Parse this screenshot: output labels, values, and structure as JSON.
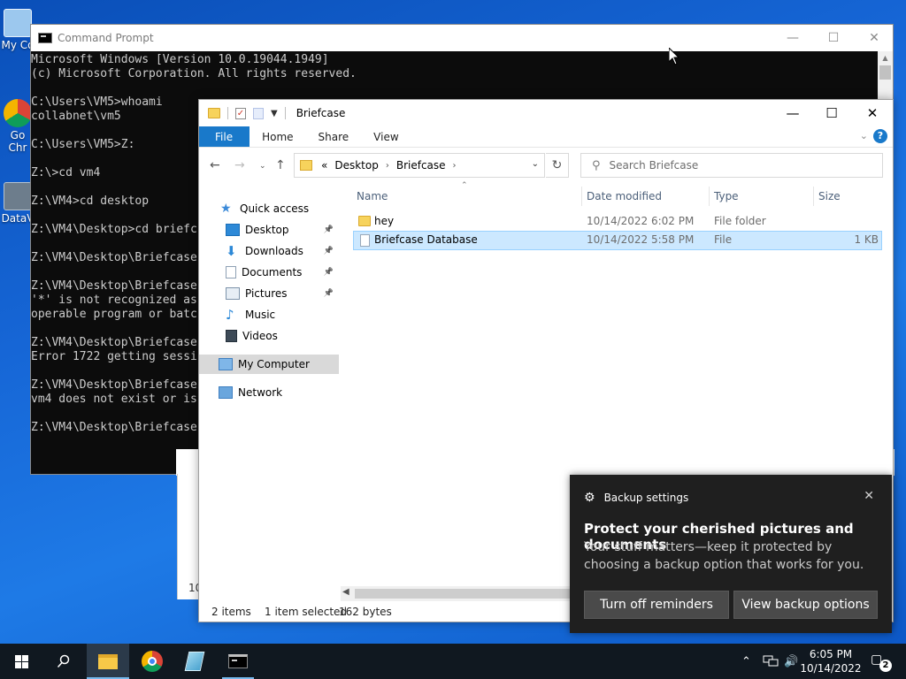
{
  "desktop": {
    "icons": [
      {
        "label": "My Co",
        "icon": "computer-icon"
      },
      {
        "label": "Go",
        "label2": "Chr",
        "icon": "chrome-icon"
      },
      {
        "label": "DataV",
        "icon": "datav-icon"
      }
    ]
  },
  "cmd": {
    "title": "Command Prompt",
    "lines": [
      "Microsoft Windows [Version 10.0.19044.1949]",
      "(c) Microsoft Corporation. All rights reserved.",
      "",
      "C:\\Users\\VM5>whoami",
      "collabnet\\vm5",
      "",
      "C:\\Users\\VM5>Z:",
      "",
      "Z:\\>cd vm4",
      "",
      "Z:\\VM4>cd desktop",
      "",
      "Z:\\VM4\\Desktop>cd briefc",
      "",
      "Z:\\VM4\\Desktop\\Briefcase",
      "",
      "Z:\\VM4\\Desktop\\Briefcase",
      "'*' is not recognized as",
      "operable program or batc",
      "",
      "Z:\\VM4\\Desktop\\Briefcase",
      "Error 1722 getting sessi",
      "",
      "Z:\\VM4\\Desktop\\Briefcase",
      "vm4 does not exist or is",
      "",
      "Z:\\VM4\\Desktop\\Briefcase"
    ]
  },
  "explorer": {
    "title": "Briefcase",
    "ribbon": {
      "file": "File",
      "home": "Home",
      "share": "Share",
      "view": "View"
    },
    "address": {
      "prefix": "«",
      "crumbs": [
        "Desktop",
        "Briefcase"
      ]
    },
    "search_placeholder": "Search Briefcase",
    "nav": [
      {
        "label": "Quick access",
        "icon": "star-icon"
      },
      {
        "label": "Desktop",
        "icon": "desktop-icon",
        "pinned": true
      },
      {
        "label": "Downloads",
        "icon": "download-icon",
        "pinned": true
      },
      {
        "label": "Documents",
        "icon": "document-icon",
        "pinned": true
      },
      {
        "label": "Pictures",
        "icon": "picture-icon",
        "pinned": true
      },
      {
        "label": "Music",
        "icon": "music-icon"
      },
      {
        "label": "Videos",
        "icon": "video-icon"
      },
      {
        "label": "My Computer",
        "icon": "computer-icon"
      },
      {
        "label": "Network",
        "icon": "network-icon"
      }
    ],
    "columns": {
      "name": "Name",
      "date": "Date modified",
      "type": "Type",
      "size": "Size"
    },
    "files": [
      {
        "name": "hey",
        "date": "10/14/2022 6:02 PM",
        "type": "File folder",
        "size": "",
        "icon": "folder-icon"
      },
      {
        "name": "Briefcase Database",
        "date": "10/14/2022 5:58 PM",
        "type": "File",
        "size": "1 KB",
        "icon": "file-icon"
      }
    ],
    "status": {
      "items": "2 items",
      "selected": "1 item selected",
      "bytes": "162 bytes"
    }
  },
  "background_window": {
    "text": "10"
  },
  "toast": {
    "header": "Backup settings",
    "title": "Protect your cherished pictures and documents",
    "body": "Your stuff matters—keep it protected by choosing a backup option that works for you.",
    "button1": "Turn off reminders",
    "button2": "View backup options"
  },
  "taskbar": {
    "time": "6:05 PM",
    "date": "10/14/2022",
    "notification_count": "2"
  },
  "colors": {
    "accent": "#1979ca",
    "selection": "#cce8ff",
    "taskbar": "#101820"
  }
}
